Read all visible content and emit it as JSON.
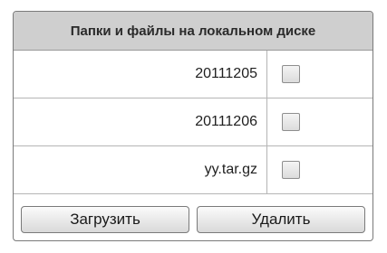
{
  "panel": {
    "title": "Папки и файлы на локальном диске"
  },
  "files": [
    {
      "name": "20111205",
      "checked": false
    },
    {
      "name": "20111206",
      "checked": false
    },
    {
      "name": "yy.tar.gz",
      "checked": false
    }
  ],
  "buttons": {
    "upload_label": "Загрузить",
    "delete_label": "Удалить"
  }
}
